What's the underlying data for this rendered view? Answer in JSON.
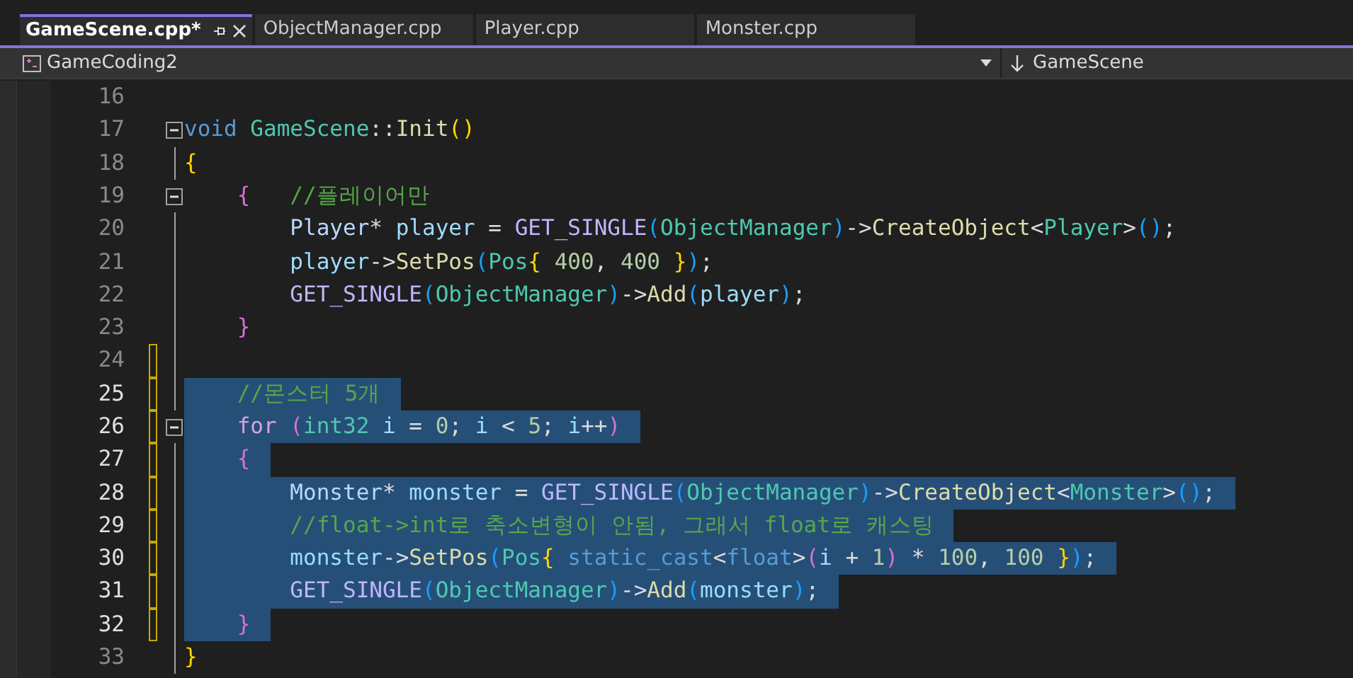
{
  "tabs": [
    {
      "label": "GameScene.cpp*",
      "selected": true
    },
    {
      "label": "ObjectManager.cpp",
      "selected": false
    },
    {
      "label": "Player.cpp",
      "selected": false
    },
    {
      "label": "Monster.cpp",
      "selected": false
    }
  ],
  "nav_bar": {
    "project": "GameCoding2",
    "scope": "GameScene"
  },
  "editor": {
    "lines": [
      {
        "number": "16",
        "selected": false,
        "changed": false
      },
      {
        "number": "17",
        "selected": false,
        "changed": false,
        "fold_button": {
          "expanded": true
        },
        "tokens": [
          {
            "text": "void ",
            "kind": "keyword"
          },
          {
            "text": "GameScene",
            "kind": "type"
          },
          {
            "text": "::",
            "kind": "plain"
          },
          {
            "text": "Init",
            "kind": "func"
          },
          {
            "text": "()",
            "kind": "paren1"
          }
        ]
      },
      {
        "number": "18",
        "selected": false,
        "changed": false,
        "tokens": [
          {
            "text": "{",
            "kind": "paren1"
          }
        ]
      },
      {
        "number": "19",
        "selected": false,
        "changed": false,
        "fold_button": {
          "expanded": true
        },
        "tokens": [
          {
            "text": "    {",
            "kind": "paren2"
          },
          {
            "text": "   //플레이어만",
            "kind": "comment"
          }
        ]
      },
      {
        "number": "20",
        "selected": false,
        "changed": false,
        "tokens": [
          {
            "text": "        Player",
            "kind": "class"
          },
          {
            "text": "* ",
            "kind": "plain"
          },
          {
            "text": "player",
            "kind": "var"
          },
          {
            "text": " = ",
            "kind": "plain"
          },
          {
            "text": "GET_SINGLE",
            "kind": "macro"
          },
          {
            "text": "(",
            "kind": "paren3"
          },
          {
            "text": "ObjectManager",
            "kind": "type"
          },
          {
            "text": ")",
            "kind": "paren3"
          },
          {
            "text": "->",
            "kind": "plain"
          },
          {
            "text": "CreateObject",
            "kind": "func"
          },
          {
            "text": "<",
            "kind": "plain"
          },
          {
            "text": "Player",
            "kind": "type"
          },
          {
            "text": ">",
            "kind": "plain"
          },
          {
            "text": "()",
            "kind": "paren3"
          },
          {
            "text": ";",
            "kind": "plain"
          }
        ]
      },
      {
        "number": "21",
        "selected": false,
        "changed": false,
        "tokens": [
          {
            "text": "        player",
            "kind": "var"
          },
          {
            "text": "->",
            "kind": "plain"
          },
          {
            "text": "SetPos",
            "kind": "func"
          },
          {
            "text": "(",
            "kind": "paren3"
          },
          {
            "text": "Pos",
            "kind": "type"
          },
          {
            "text": "{ ",
            "kind": "paren1"
          },
          {
            "text": "400",
            "kind": "number"
          },
          {
            "text": ", ",
            "kind": "plain"
          },
          {
            "text": "400",
            "kind": "number"
          },
          {
            "text": " }",
            "kind": "paren1"
          },
          {
            "text": ")",
            "kind": "paren3"
          },
          {
            "text": ";",
            "kind": "plain"
          }
        ]
      },
      {
        "number": "22",
        "selected": false,
        "changed": false,
        "tokens": [
          {
            "text": "        GET_SINGLE",
            "kind": "macro"
          },
          {
            "text": "(",
            "kind": "paren3"
          },
          {
            "text": "ObjectManager",
            "kind": "type"
          },
          {
            "text": ")",
            "kind": "paren3"
          },
          {
            "text": "->",
            "kind": "plain"
          },
          {
            "text": "Add",
            "kind": "func"
          },
          {
            "text": "(",
            "kind": "paren3"
          },
          {
            "text": "player",
            "kind": "var"
          },
          {
            "text": ")",
            "kind": "paren3"
          },
          {
            "text": ";",
            "kind": "plain"
          }
        ]
      },
      {
        "number": "23",
        "selected": false,
        "changed": false,
        "tokens": [
          {
            "text": "    }",
            "kind": "paren2"
          }
        ]
      },
      {
        "number": "24",
        "selected": false,
        "changed": true
      },
      {
        "number": "25",
        "selected": true,
        "changed": true,
        "tokens": [
          {
            "text": "    //몬스터 5개",
            "kind": "comment"
          }
        ]
      },
      {
        "number": "26",
        "selected": true,
        "changed": true,
        "fold_button": {
          "expanded": true
        },
        "tokens": [
          {
            "text": "    for ",
            "kind": "keyword2"
          },
          {
            "text": "(",
            "kind": "paren2"
          },
          {
            "text": "int32",
            "kind": "type"
          },
          {
            "text": " i",
            "kind": "var"
          },
          {
            "text": " = ",
            "kind": "plain"
          },
          {
            "text": "0",
            "kind": "number"
          },
          {
            "text": "; ",
            "kind": "plain"
          },
          {
            "text": "i",
            "kind": "var"
          },
          {
            "text": " < ",
            "kind": "plain"
          },
          {
            "text": "5",
            "kind": "number"
          },
          {
            "text": "; ",
            "kind": "plain"
          },
          {
            "text": "i",
            "kind": "var"
          },
          {
            "text": "++",
            "kind": "plain"
          },
          {
            "text": ")",
            "kind": "paren2"
          }
        ]
      },
      {
        "number": "27",
        "selected": true,
        "changed": true,
        "tokens": [
          {
            "text": "    {",
            "kind": "paren2"
          }
        ]
      },
      {
        "number": "28",
        "selected": true,
        "changed": true,
        "tokens": [
          {
            "text": "        Monster",
            "kind": "class"
          },
          {
            "text": "* ",
            "kind": "plain"
          },
          {
            "text": "monster",
            "kind": "var"
          },
          {
            "text": " = ",
            "kind": "plain"
          },
          {
            "text": "GET_SINGLE",
            "kind": "macro"
          },
          {
            "text": "(",
            "kind": "paren3"
          },
          {
            "text": "ObjectManager",
            "kind": "type"
          },
          {
            "text": ")",
            "kind": "paren3"
          },
          {
            "text": "->",
            "kind": "plain"
          },
          {
            "text": "CreateObject",
            "kind": "func"
          },
          {
            "text": "<",
            "kind": "plain"
          },
          {
            "text": "Monster",
            "kind": "type"
          },
          {
            "text": ">",
            "kind": "plain"
          },
          {
            "text": "()",
            "kind": "paren3"
          },
          {
            "text": ";",
            "kind": "plain"
          }
        ]
      },
      {
        "number": "29",
        "selected": true,
        "changed": true,
        "tokens": [
          {
            "text": "        //float->int로 축소변형이 안됨, 그래서 float로 캐스팅",
            "kind": "comment"
          }
        ]
      },
      {
        "number": "30",
        "selected": true,
        "changed": true,
        "tokens": [
          {
            "text": "        monster",
            "kind": "var"
          },
          {
            "text": "->",
            "kind": "plain"
          },
          {
            "text": "SetPos",
            "kind": "func"
          },
          {
            "text": "(",
            "kind": "paren3"
          },
          {
            "text": "Pos",
            "kind": "type"
          },
          {
            "text": "{ ",
            "kind": "paren1"
          },
          {
            "text": "static_cast",
            "kind": "keyword"
          },
          {
            "text": "<",
            "kind": "plain"
          },
          {
            "text": "float",
            "kind": "keyword"
          },
          {
            "text": ">",
            "kind": "plain"
          },
          {
            "text": "(",
            "kind": "paren2"
          },
          {
            "text": "i",
            "kind": "var"
          },
          {
            "text": " + ",
            "kind": "plain"
          },
          {
            "text": "1",
            "kind": "number"
          },
          {
            "text": ")",
            "kind": "paren2"
          },
          {
            "text": " * ",
            "kind": "plain"
          },
          {
            "text": "100",
            "kind": "number"
          },
          {
            "text": ", ",
            "kind": "plain"
          },
          {
            "text": "100",
            "kind": "number"
          },
          {
            "text": " }",
            "kind": "paren1"
          },
          {
            "text": ")",
            "kind": "paren3"
          },
          {
            "text": ";",
            "kind": "plain"
          }
        ]
      },
      {
        "number": "31",
        "selected": true,
        "changed": true,
        "tokens": [
          {
            "text": "        GET_SINGLE",
            "kind": "macro"
          },
          {
            "text": "(",
            "kind": "paren3"
          },
          {
            "text": "ObjectManager",
            "kind": "type"
          },
          {
            "text": ")",
            "kind": "paren3"
          },
          {
            "text": "->",
            "kind": "plain"
          },
          {
            "text": "Add",
            "kind": "func"
          },
          {
            "text": "(",
            "kind": "paren3"
          },
          {
            "text": "monster",
            "kind": "var"
          },
          {
            "text": ")",
            "kind": "paren3"
          },
          {
            "text": ";",
            "kind": "plain"
          }
        ]
      },
      {
        "number": "32",
        "selected": true,
        "changed": true,
        "tokens": [
          {
            "text": "    }",
            "kind": "paren2"
          }
        ]
      },
      {
        "number": "33",
        "selected": false,
        "changed": false,
        "tokens": [
          {
            "text": "}",
            "kind": "paren1"
          }
        ]
      }
    ]
  }
}
